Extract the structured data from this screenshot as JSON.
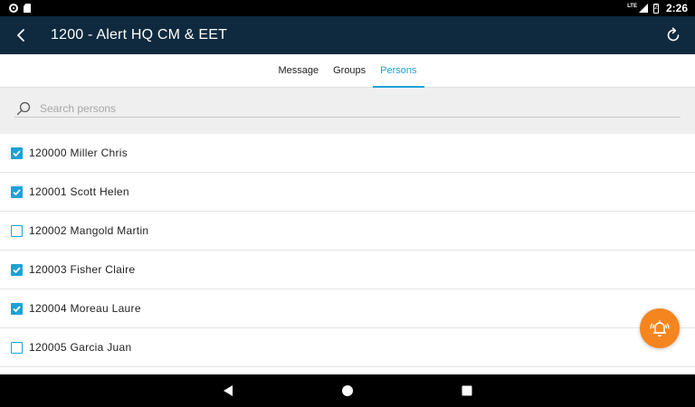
{
  "status_bar": {
    "network": "LTE",
    "battery": "2",
    "time": "2:26"
  },
  "app_bar": {
    "title": "1200 - Alert HQ CM & EET",
    "back_icon": "chevron-left-icon",
    "refresh_icon": "refresh-icon"
  },
  "tabs": [
    {
      "label": "Message",
      "active": false
    },
    {
      "label": "Groups",
      "active": false
    },
    {
      "label": "Persons",
      "active": true
    }
  ],
  "search": {
    "placeholder": "Search persons",
    "value": ""
  },
  "persons": [
    {
      "label": "120000 Miller Chris",
      "checked": true
    },
    {
      "label": "120001 Scott Helen",
      "checked": true
    },
    {
      "label": "120002 Mangold Martin",
      "checked": false
    },
    {
      "label": "120003 Fisher Claire",
      "checked": true
    },
    {
      "label": "120004 Moreau Laure",
      "checked": true
    },
    {
      "label": "120005 Garcia Juan",
      "checked": false
    }
  ],
  "colors": {
    "app_bar": "#0f2a3f",
    "accent": "#1ba2d8",
    "fab": "#f5851f"
  },
  "fab": {
    "icon": "alarm-bell-icon"
  }
}
